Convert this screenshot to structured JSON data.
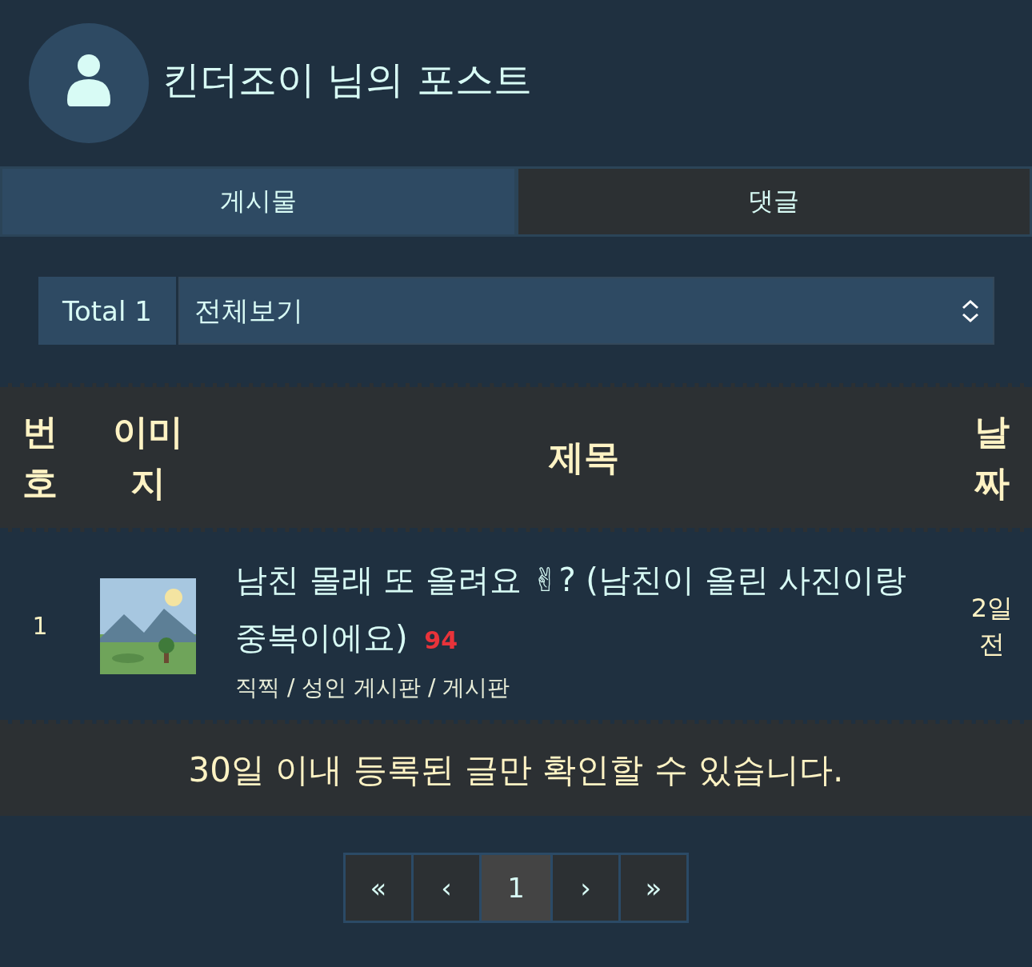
{
  "profile": {
    "title": "킨더조이 님의 포스트"
  },
  "tabs": [
    {
      "label": "게시물",
      "selected": true
    },
    {
      "label": "댓글",
      "selected": false
    }
  ],
  "filter": {
    "total": "Total 1",
    "value": "전체보기"
  },
  "table": {
    "columns": [
      "번호",
      "이미지",
      "제목",
      "날짜"
    ],
    "rows": [
      {
        "number": "1",
        "title": "남친 몰래 또 올려요 ✌? (남친이 올린 사진이랑 중복이에요)",
        "comments": "94",
        "board": "직찍 / 성인 게시판 / 게시판",
        "date": "2일 전"
      }
    ]
  },
  "notice": "30일 이내 등록된 글만 확인할 수 있습니다.",
  "pagination": [
    {
      "label": "«",
      "selected": false
    },
    {
      "label": "‹",
      "selected": false
    },
    {
      "label": "1",
      "selected": true
    },
    {
      "label": "›",
      "selected": false
    },
    {
      "label": "»",
      "selected": false
    }
  ]
}
